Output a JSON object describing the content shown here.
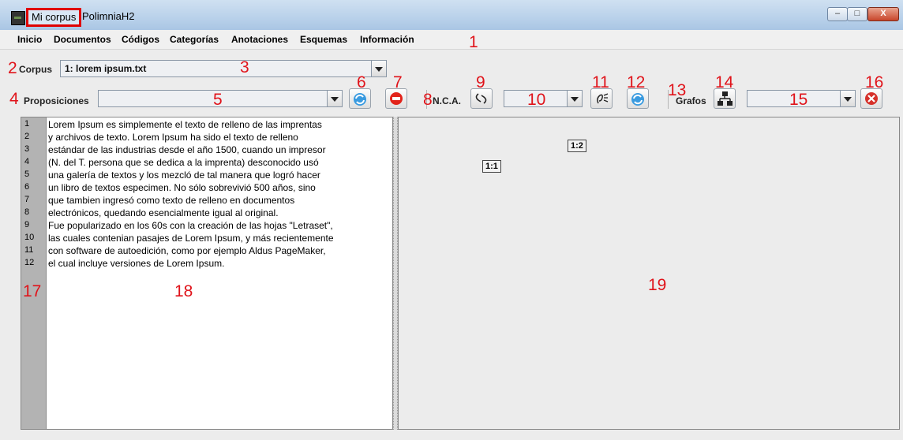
{
  "window": {
    "title": "Mi corpus",
    "app_name": "PolimniaH2",
    "min_label": "–",
    "max_label": "□",
    "close_label": "X"
  },
  "menu": {
    "items": [
      "Inicio",
      "Documentos",
      "Códigos",
      "Categorías",
      "Anotaciones",
      "Esquemas",
      "Información"
    ]
  },
  "corpus": {
    "label": "Corpus",
    "selected": "1: lorem ipsum.txt"
  },
  "toolbar": {
    "proposiciones_label": "Proposiciones",
    "proposiciones_value": "",
    "nca_label": "N.C.A.",
    "nca_value": "",
    "grafos_label": "Grafos",
    "grafos_value": ""
  },
  "annotations": [
    "1",
    "2",
    "3",
    "4",
    "5",
    "6",
    "7",
    "8",
    "9",
    "10",
    "11",
    "12",
    "13",
    "14",
    "15",
    "16",
    "17",
    "18",
    "19"
  ],
  "icons": {
    "refresh": "refresh-icon",
    "stop": "stop-icon",
    "link": "link-icon",
    "gesture": "gesture-icon",
    "tree": "tree-icon",
    "close": "close-icon"
  },
  "line_numbers": [
    "1",
    "2",
    "3",
    "4",
    "5",
    "6",
    "7",
    "8",
    "9",
    "10",
    "11",
    "12"
  ],
  "text_lines": [
    "Lorem Ipsum es simplemente el texto de relleno de las imprentas",
    "y archivos de texto. Lorem Ipsum ha sido el texto de relleno",
    "estándar de las industrias desde el año 1500, cuando un impresor",
    "(N. del T. persona que se dedica a la imprenta) desconocido usó",
    "una galería de textos y los mezcló de tal manera que logró hacer",
    "un libro de textos especimen. No sólo sobrevivió 500 años, sino",
    "que tambien ingresó como texto de relleno en documentos",
    "electrónicos, quedando esencialmente igual al original.",
    "Fue popularizado en los 60s con la creación de las hojas \"Letraset\",",
    "las cuales contenian pasajes de Lorem Ipsum, y más recientemente",
    "con software de autoedición, como por ejemplo Aldus PageMaker,",
    "el cual incluye versiones de Lorem Ipsum."
  ],
  "graph_nodes": [
    "1:1",
    "1:2"
  ]
}
